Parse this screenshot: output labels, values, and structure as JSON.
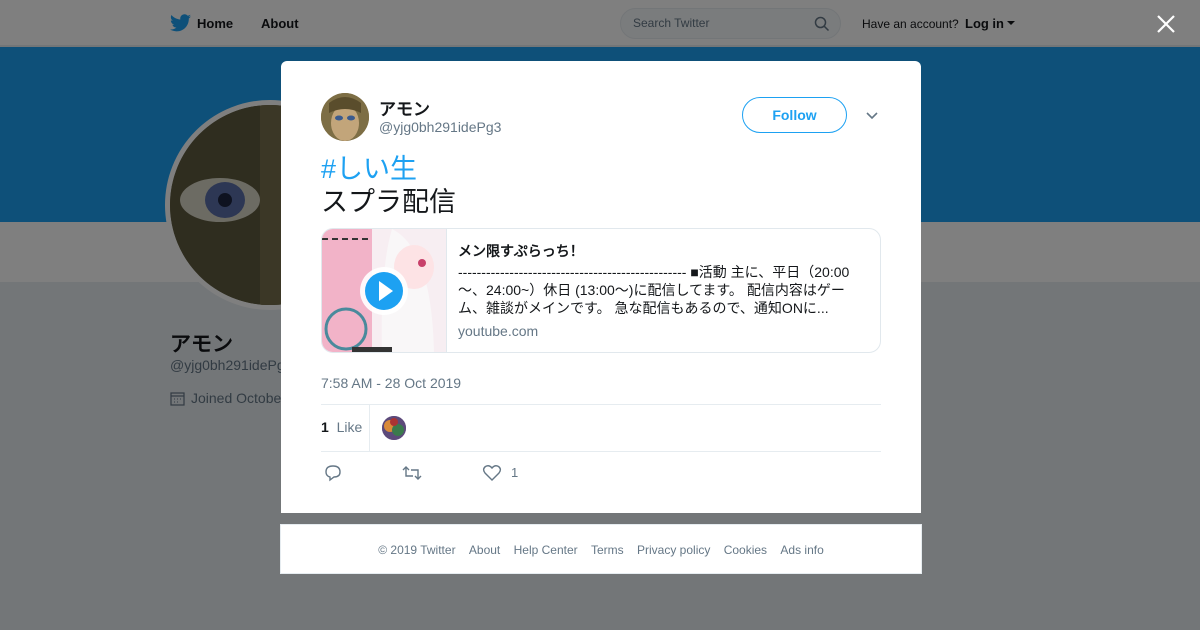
{
  "nav": {
    "home_label": "Home",
    "about_label": "About",
    "search_placeholder": "Search Twitter",
    "have_account": "Have an account?",
    "login_label": "Log in"
  },
  "profile": {
    "name": "アモン",
    "handle": "@yjg0bh291idePg3",
    "joined": "Joined October"
  },
  "tweet": {
    "author_name": "アモン",
    "author_handle": "@yjg0bh291idePg3",
    "follow_label": "Follow",
    "hashtag": "#しい生",
    "text": "スプラ配信",
    "card": {
      "title": "メン限すぷらっち！",
      "description": "------------------------------------------------- ■活動 主に、平日（20:00～、24:00~）休日 (13:00～)に配信してます。 配信内容はゲーム、雑談がメインです。 急な配信もあるので、通知ONに...",
      "domain": "youtube.com"
    },
    "timestamp": "7:58 AM - 28 Oct 2019",
    "like_count": "1",
    "like_label": "Like",
    "like_action_count": "1"
  },
  "footer": {
    "links": [
      "© 2019 Twitter",
      "About",
      "Help Center",
      "Terms",
      "Privacy policy",
      "Cookies",
      "Ads info"
    ]
  },
  "colors": {
    "brand": "#1da1f2",
    "text": "#14171a",
    "muted": "#657786"
  }
}
